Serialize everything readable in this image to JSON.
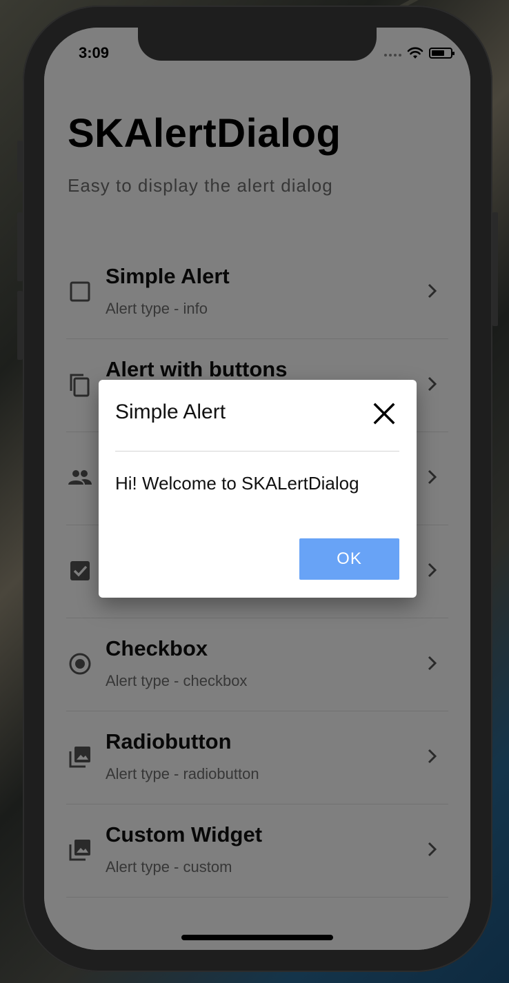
{
  "status_bar": {
    "time": "3:09"
  },
  "app": {
    "title": "SKAlertDialog",
    "subtitle": "Easy to display the alert dialog"
  },
  "list": [
    {
      "title": "Simple Alert",
      "subtitle": "Alert type - info",
      "icon": "checkbox-blank-icon"
    },
    {
      "title": "Alert with buttons",
      "subtitle": "",
      "icon": "copy-icon"
    },
    {
      "title": "",
      "subtitle": "",
      "icon": "people-icon"
    },
    {
      "title": "",
      "subtitle": "",
      "icon": "checkbox-checked-icon"
    },
    {
      "title": "Checkbox",
      "subtitle": "Alert type - checkbox",
      "icon": "radio-button-icon"
    },
    {
      "title": "Radiobutton",
      "subtitle": "Alert type - radiobutton",
      "icon": "photo-library-icon"
    },
    {
      "title": "Custom Widget",
      "subtitle": "Alert type - custom",
      "icon": "photo-library-icon"
    }
  ],
  "dialog": {
    "title": "Simple Alert",
    "message": "Hi! Welcome to SKALertDialog",
    "ok_label": "OK"
  },
  "colors": {
    "ok_button": "#68a3f6",
    "overlay": "rgba(0,0,0,0.5)"
  }
}
